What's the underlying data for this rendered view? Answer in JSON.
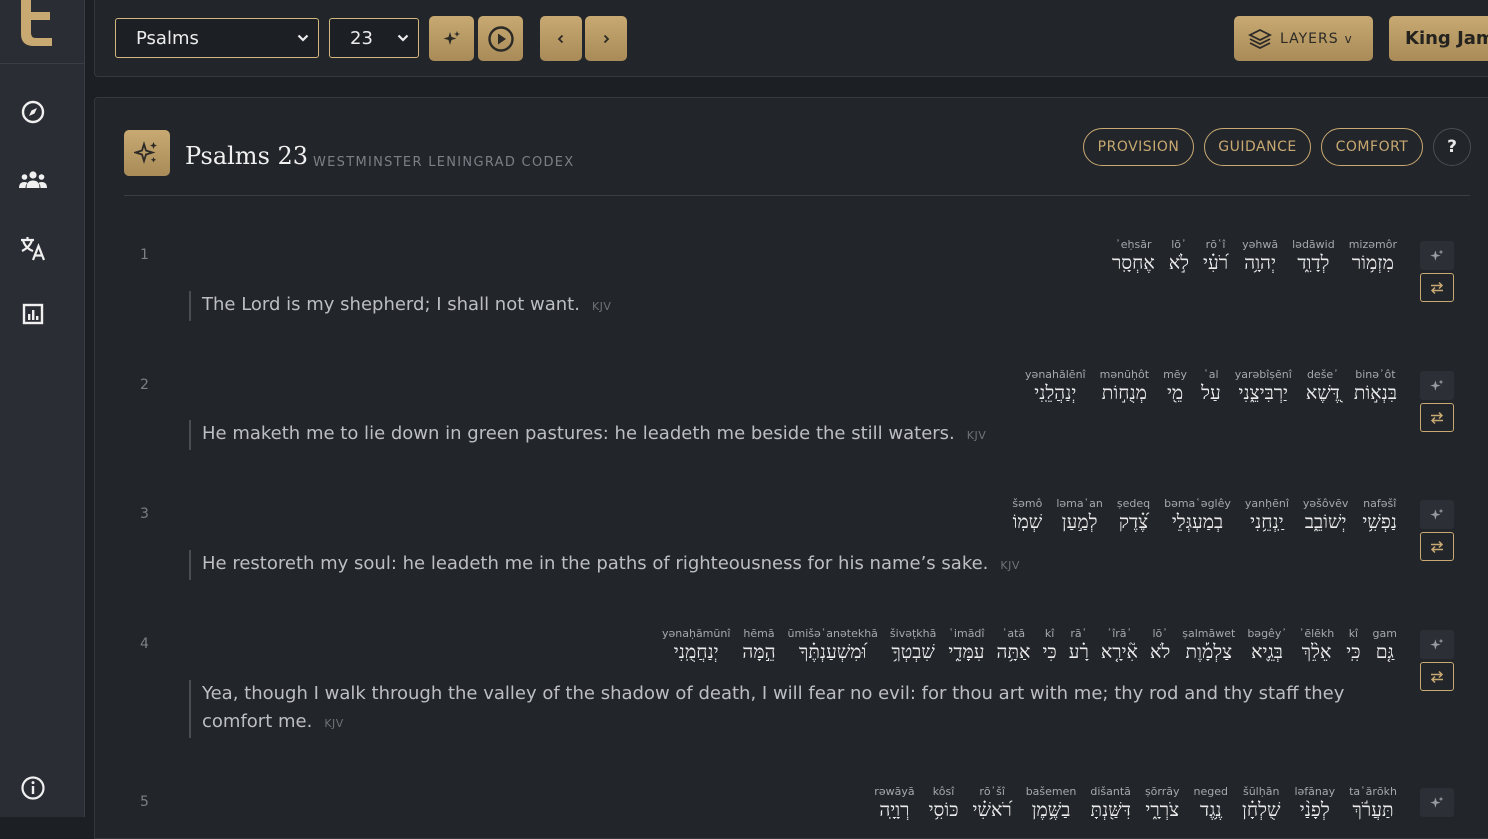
{
  "sidebar": {
    "logo_letter": "t"
  },
  "toolbar": {
    "book": "Psalms",
    "chapter": "23",
    "layers_label": "LAYERS",
    "layers_caret": "v",
    "translation_label": "King James"
  },
  "header": {
    "title": "Psalms 23",
    "subtitle": "WESTMINSTER LENINGRAD CODEX",
    "themes": [
      "PROVISION",
      "GUIDANCE",
      "COMFORT"
    ],
    "help": "?"
  },
  "verses": [
    {
      "num": "1",
      "words": [
        {
          "t": "mizəmôr",
          "h": "מִזְמ֥וֹר"
        },
        {
          "t": "lədāwid",
          "h": "לְדָוִ֑ד"
        },
        {
          "t": "yəhwā",
          "h": "יְהוָ֥ה"
        },
        {
          "t": "rō῾î",
          "h": "רֹ֝עִ֗י"
        },
        {
          "t": "lō᾽",
          "h": "לֹ֣א"
        },
        {
          "t": "᾽eḥsār",
          "h": "אֶחְסָֽר"
        }
      ],
      "text": "The Lord is my shepherd; I shall not want.",
      "source": "KJV"
    },
    {
      "num": "2",
      "words": [
        {
          "t": "binə᾽ôt",
          "h": "בִּנְא֣וֹת"
        },
        {
          "t": "deše᾽",
          "h": "דֶּ֭שֶׁא"
        },
        {
          "t": "yarəbîṣēnî",
          "h": "יַרְבִּיצֵ֑נִי"
        },
        {
          "t": "῾al",
          "h": "עַל"
        },
        {
          "t": "mēy",
          "h": "מֵ֖י"
        },
        {
          "t": "mənūḥôt",
          "h": "מְנֻח֣וֹת"
        },
        {
          "t": "yənahălēnî",
          "h": "יְנַהֲלֵֽנִי"
        }
      ],
      "text": "He maketh me to lie down in green pastures: he leadeth me beside the still waters.",
      "source": "KJV"
    },
    {
      "num": "3",
      "words": [
        {
          "t": "nafəšî",
          "h": "נַפְשִׁ֥י"
        },
        {
          "t": "yəšôvēv",
          "h": "יְשׁוֹבֵ֑ב"
        },
        {
          "t": "yanḥēnî",
          "h": "יַֽנְחֵ֥נִי"
        },
        {
          "t": "bəma῾əglêy",
          "h": "בְמַעְגְּלֵי"
        },
        {
          "t": "ṣedeq",
          "h": "צֶ֝֗דֶק"
        },
        {
          "t": "ləma῾an",
          "h": "לְמַ֣עַן"
        },
        {
          "t": "šəmô",
          "h": "שְׁמֽוֹ"
        }
      ],
      "text": "He restoreth my soul: he leadeth me in the paths of righteousness for his name’s sake.",
      "source": "KJV"
    },
    {
      "num": "4",
      "words": [
        {
          "t": "gam",
          "h": "גַּ֤ם"
        },
        {
          "t": "kî",
          "h": "כִּֽי"
        },
        {
          "t": "᾽ēlēkh",
          "h": "אֵלֵ֨ךְ"
        },
        {
          "t": "bəgêy᾽",
          "h": "בְּגֵ֪יא"
        },
        {
          "t": "ṣalmāwet",
          "h": "צַלְמָ֡וֶת"
        },
        {
          "t": "lō᾽",
          "h": "לֹא"
        },
        {
          "t": "᾽îrā᾽",
          "h": "אִ֘ירָ֤א"
        },
        {
          "t": "rā῾",
          "h": "רָ֗ע"
        },
        {
          "t": "kî",
          "h": "כִּי"
        },
        {
          "t": "᾽atā",
          "h": "אַתָּ֥ה"
        },
        {
          "t": "῾imādî",
          "h": "עִמָּדִ֑י"
        },
        {
          "t": "šivəṭkhā",
          "h": "שִׁבְטְךָ֥"
        },
        {
          "t": "ūmišə῾anətekhā",
          "h": "וּ֝מִשְׁעַנְתֶּ֗ךָ"
        },
        {
          "t": "hēmā",
          "h": "הֵ֣מָּה"
        },
        {
          "t": "yənaḥămūnî",
          "h": "יְנַחֲמֻֽנִי"
        }
      ],
      "text": "Yea, though I walk through the valley of the shadow of death, I will fear no evil: for thou art with me; thy rod and thy staff they comfort me.",
      "source": "KJV"
    },
    {
      "num": "5",
      "words": [
        {
          "t": "ta῾ărōkh",
          "h": "תַּעֲרֹ֬ךְ"
        },
        {
          "t": "ləfānay",
          "h": "לְפָנַ֨י"
        },
        {
          "t": "šūlḥān",
          "h": "שֻׁלְחָ֗ן"
        },
        {
          "t": "neged",
          "h": "נֶ֥גֶד"
        },
        {
          "t": "ṣōrrāy",
          "h": "צֹרְרָ֑י"
        },
        {
          "t": "dišantā",
          "h": "דִּשַּׁ֖נְתָּ"
        },
        {
          "t": "bašemen",
          "h": "בַשֶּׁ֥מֶן"
        },
        {
          "t": "rō᾽šî",
          "h": "רֹ֝אשִׁ֗י"
        },
        {
          "t": "kôsî",
          "h": "כּוֹסִ֥י"
        },
        {
          "t": "rəwāyā",
          "h": "רְוָיָֽה"
        }
      ],
      "text": "",
      "source": ""
    }
  ],
  "colors": {
    "accent": "#c8a972",
    "background": "#1c1f24",
    "panel": "#22252a"
  },
  "icons": [
    "compass-icon",
    "users-icon",
    "translate-icon",
    "chart-icon",
    "info-icon",
    "sparkle-icon",
    "play-icon",
    "chevron-left-icon",
    "chevron-right-icon",
    "layers-icon",
    "swap-icon"
  ]
}
